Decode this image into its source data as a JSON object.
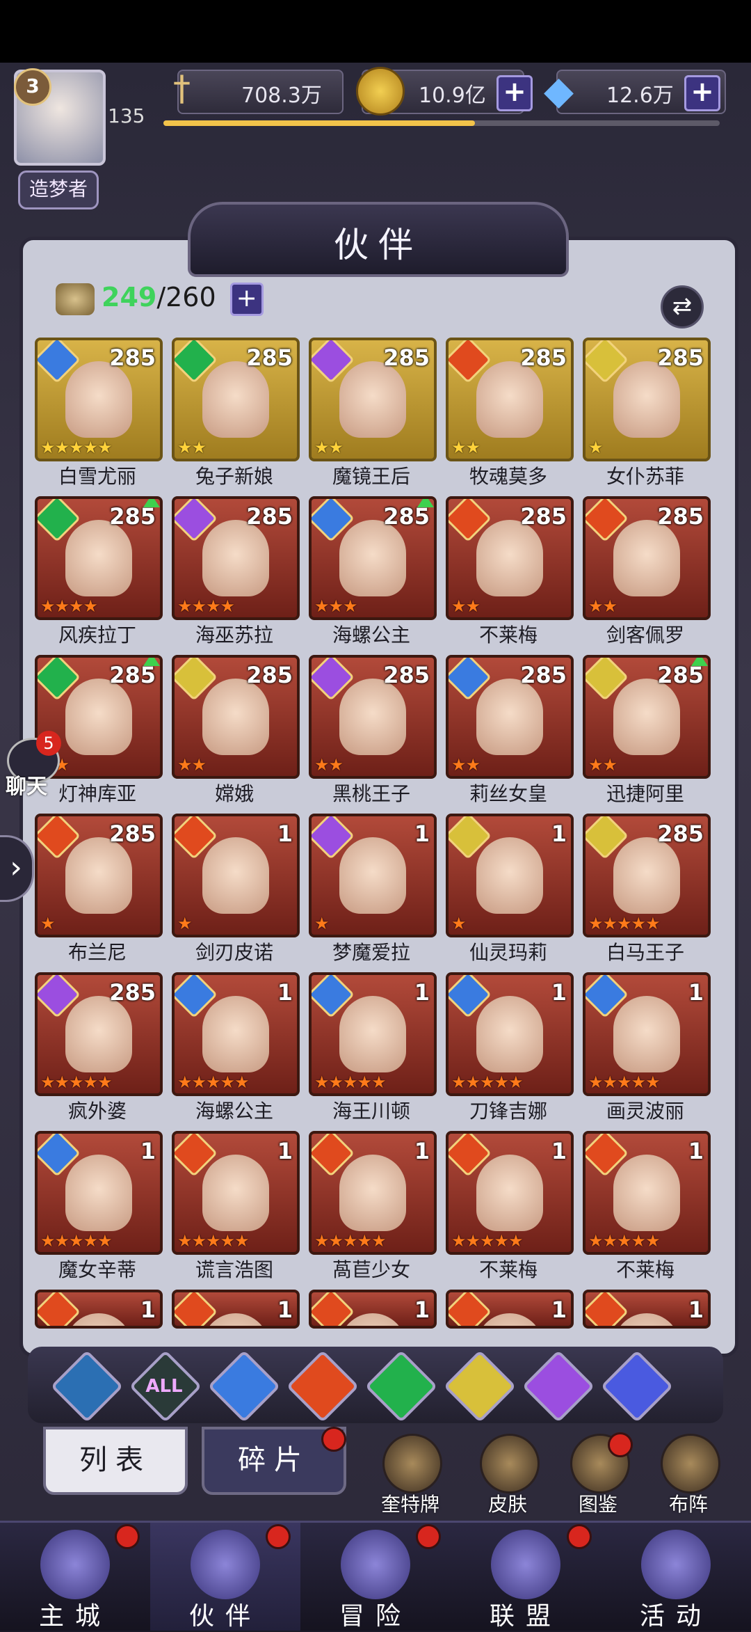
{
  "player": {
    "level": "3",
    "exp": "135",
    "title": "造梦者",
    "exp_progress": 0.56
  },
  "resources": {
    "power": "708.3万",
    "gold": "10.9亿",
    "diamond": "12.6万"
  },
  "panel": {
    "title": "伙伴",
    "count_current": "249",
    "count_max": "/260"
  },
  "heroes": [
    {
      "name": "白雪尤丽",
      "level": "285",
      "frame": "gold",
      "element": "water",
      "stars": "★★★★★",
      "star_color": "y",
      "up": false
    },
    {
      "name": "兔子新娘",
      "level": "285",
      "frame": "gold",
      "element": "wind",
      "stars": "★★",
      "star_color": "y",
      "up": false
    },
    {
      "name": "魔镜王后",
      "level": "285",
      "frame": "gold",
      "element": "moon",
      "stars": "★★",
      "star_color": "y",
      "up": false
    },
    {
      "name": "牧魂莫多",
      "level": "285",
      "frame": "gold",
      "element": "fire",
      "stars": "★★",
      "star_color": "y",
      "up": false
    },
    {
      "name": "女仆苏菲",
      "level": "285",
      "frame": "gold",
      "element": "light",
      "stars": "★",
      "star_color": "y",
      "up": false
    },
    {
      "name": "风疾拉丁",
      "level": "285",
      "frame": "red",
      "element": "wind",
      "stars": "★★★★",
      "star_color": "o",
      "up": true
    },
    {
      "name": "海巫苏拉",
      "level": "285",
      "frame": "red",
      "element": "moon",
      "stars": "★★★★",
      "star_color": "o",
      "up": false
    },
    {
      "name": "海螺公主",
      "level": "285",
      "frame": "red",
      "element": "water",
      "stars": "★★★",
      "star_color": "o",
      "up": true
    },
    {
      "name": "不莱梅",
      "level": "285",
      "frame": "red",
      "element": "fire",
      "stars": "★★",
      "star_color": "o",
      "up": false
    },
    {
      "name": "剑客佩罗",
      "level": "285",
      "frame": "red",
      "element": "fire",
      "stars": "★★",
      "star_color": "o",
      "up": false
    },
    {
      "name": "灯神库亚",
      "level": "285",
      "frame": "red",
      "element": "wind",
      "stars": "★★",
      "star_color": "o",
      "up": true
    },
    {
      "name": "嫦娥",
      "level": "285",
      "frame": "red",
      "element": "light",
      "stars": "★★",
      "star_color": "o",
      "up": false
    },
    {
      "name": "黑桃王子",
      "level": "285",
      "frame": "red",
      "element": "moon",
      "stars": "★★",
      "star_color": "o",
      "up": false
    },
    {
      "name": "莉丝女皇",
      "level": "285",
      "frame": "red",
      "element": "water",
      "stars": "★★",
      "star_color": "o",
      "up": false
    },
    {
      "name": "迅捷阿里",
      "level": "285",
      "frame": "red",
      "element": "light",
      "stars": "★★",
      "star_color": "o",
      "up": true
    },
    {
      "name": "布兰尼",
      "level": "285",
      "frame": "red",
      "element": "fire",
      "stars": "★",
      "star_color": "o",
      "up": false
    },
    {
      "name": "剑刃皮诺",
      "level": "1",
      "frame": "red",
      "element": "fire",
      "stars": "★",
      "star_color": "o",
      "up": false
    },
    {
      "name": "梦魔爱拉",
      "level": "1",
      "frame": "red",
      "element": "moon",
      "stars": "★",
      "star_color": "o",
      "up": false
    },
    {
      "name": "仙灵玛莉",
      "level": "1",
      "frame": "red",
      "element": "light",
      "stars": "★",
      "star_color": "o",
      "up": false
    },
    {
      "name": "白马王子",
      "level": "285",
      "frame": "red",
      "element": "light",
      "stars": "★★★★★",
      "star_color": "o",
      "up": false
    },
    {
      "name": "疯外婆",
      "level": "285",
      "frame": "red",
      "element": "moon",
      "stars": "★★★★★",
      "star_color": "o",
      "up": false
    },
    {
      "name": "海螺公主",
      "level": "1",
      "frame": "red",
      "element": "water",
      "stars": "★★★★★",
      "star_color": "o",
      "up": false
    },
    {
      "name": "海王川顿",
      "level": "1",
      "frame": "red",
      "element": "water",
      "stars": "★★★★★",
      "star_color": "o",
      "up": false
    },
    {
      "name": "刀锋吉娜",
      "level": "1",
      "frame": "red",
      "element": "water",
      "stars": "★★★★★",
      "star_color": "o",
      "up": false
    },
    {
      "name": "画灵波丽",
      "level": "1",
      "frame": "red",
      "element": "water",
      "stars": "★★★★★",
      "star_color": "o",
      "up": false
    },
    {
      "name": "魔女辛蒂",
      "level": "1",
      "frame": "red",
      "element": "water",
      "stars": "★★★★★",
      "star_color": "o",
      "up": false
    },
    {
      "name": "谎言浩图",
      "level": "1",
      "frame": "red",
      "element": "fire",
      "stars": "★★★★★",
      "star_color": "o",
      "up": false
    },
    {
      "name": "萵苣少女",
      "level": "1",
      "frame": "red",
      "element": "fire",
      "stars": "★★★★★",
      "star_color": "o",
      "up": false
    },
    {
      "name": "不莱梅",
      "level": "1",
      "frame": "red",
      "element": "fire",
      "stars": "★★★★★",
      "star_color": "o",
      "up": false
    },
    {
      "name": "不莱梅",
      "level": "1",
      "frame": "red",
      "element": "fire",
      "stars": "★★★★★",
      "star_color": "o",
      "up": false
    },
    {
      "name": "",
      "level": "1",
      "frame": "red",
      "element": "fire",
      "stars": "",
      "star_color": "o",
      "up": false
    },
    {
      "name": "",
      "level": "1",
      "frame": "red",
      "element": "fire",
      "stars": "",
      "star_color": "o",
      "up": false
    },
    {
      "name": "",
      "level": "1",
      "frame": "red",
      "element": "fire",
      "stars": "",
      "star_color": "o",
      "up": false
    },
    {
      "name": "",
      "level": "1",
      "frame": "red",
      "element": "fire",
      "stars": "",
      "star_color": "o",
      "up": false
    },
    {
      "name": "",
      "level": "1",
      "frame": "red",
      "element": "fire",
      "stars": "",
      "star_color": "o",
      "up": false
    }
  ],
  "element_colors": {
    "water": "#3a7be0",
    "wind": "#22b14c",
    "moon": "#9b4ee0",
    "fire": "#e04a1e",
    "light": "#d8c03a"
  },
  "filters": [
    {
      "id": "none",
      "label": ""
    },
    {
      "id": "all",
      "label": "ALL"
    },
    {
      "id": "water",
      "label": ""
    },
    {
      "id": "fire",
      "label": ""
    },
    {
      "id": "wind",
      "label": ""
    },
    {
      "id": "light",
      "label": ""
    },
    {
      "id": "moon",
      "label": ""
    },
    {
      "id": "planet",
      "label": ""
    }
  ],
  "tabs": {
    "list": "列表",
    "shards": "碎片"
  },
  "side_buttons": [
    "奎特牌",
    "皮肤",
    "图鉴",
    "布阵"
  ],
  "chat": {
    "label": "聊天",
    "badge": "5"
  },
  "nav": [
    "主城",
    "伙伴",
    "冒险",
    "联盟",
    "活动"
  ]
}
